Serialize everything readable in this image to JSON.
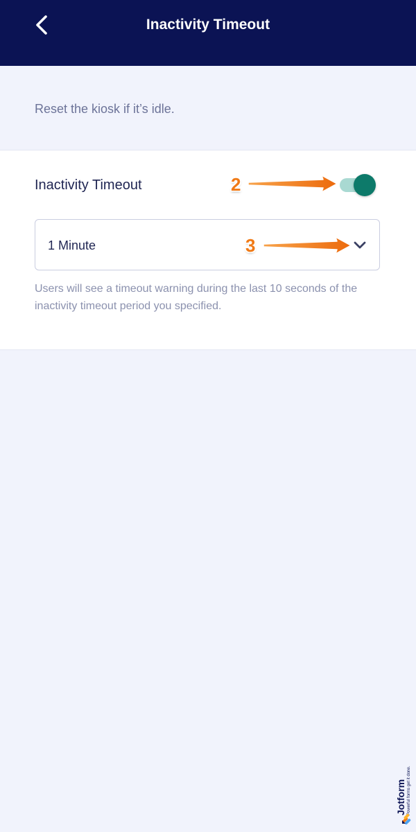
{
  "app_bar": {
    "title": "Inactivity Timeout",
    "back_icon": "chevron-left-icon"
  },
  "intro": {
    "text": "Reset the kiosk if it’s idle."
  },
  "setting": {
    "label": "Inactivity Timeout",
    "toggle_on": true,
    "dropdown_value": "1 Minute",
    "dropdown_icon": "chevron-down-icon",
    "helper_text": "Users will see a timeout warning during the last 10 seconds of the inactivity timeout period you specified."
  },
  "annotations": [
    {
      "label": "2"
    },
    {
      "label": "3"
    }
  ],
  "watermark": {
    "brand": "Jotform",
    "tagline": "Powerful forms get it done."
  },
  "colors": {
    "app_bar": "#0b1354",
    "page_background": "#f1f3fc",
    "toggle_thumb": "#0d7a6a",
    "toggle_track": "#a9d9d2",
    "annotation": "#f07a16"
  }
}
